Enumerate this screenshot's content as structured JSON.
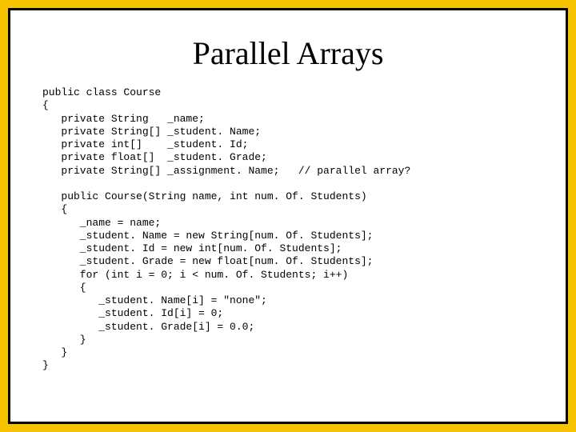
{
  "title": "Parallel Arrays",
  "code": "public class Course\n{\n   private String   _name;\n   private String[] _student. Name;\n   private int[]    _student. Id;\n   private float[]  _student. Grade;\n   private String[] _assignment. Name;   // parallel array?\n\n   public Course(String name, int num. Of. Students)\n   {\n      _name = name;\n      _student. Name = new String[num. Of. Students];\n      _student. Id = new int[num. Of. Students];\n      _student. Grade = new float[num. Of. Students];\n      for (int i = 0; i < num. Of. Students; i++)\n      {\n         _student. Name[i] = \"none\";\n         _student. Id[i] = 0;\n         _student. Grade[i] = 0.0;\n      }\n   }\n}"
}
